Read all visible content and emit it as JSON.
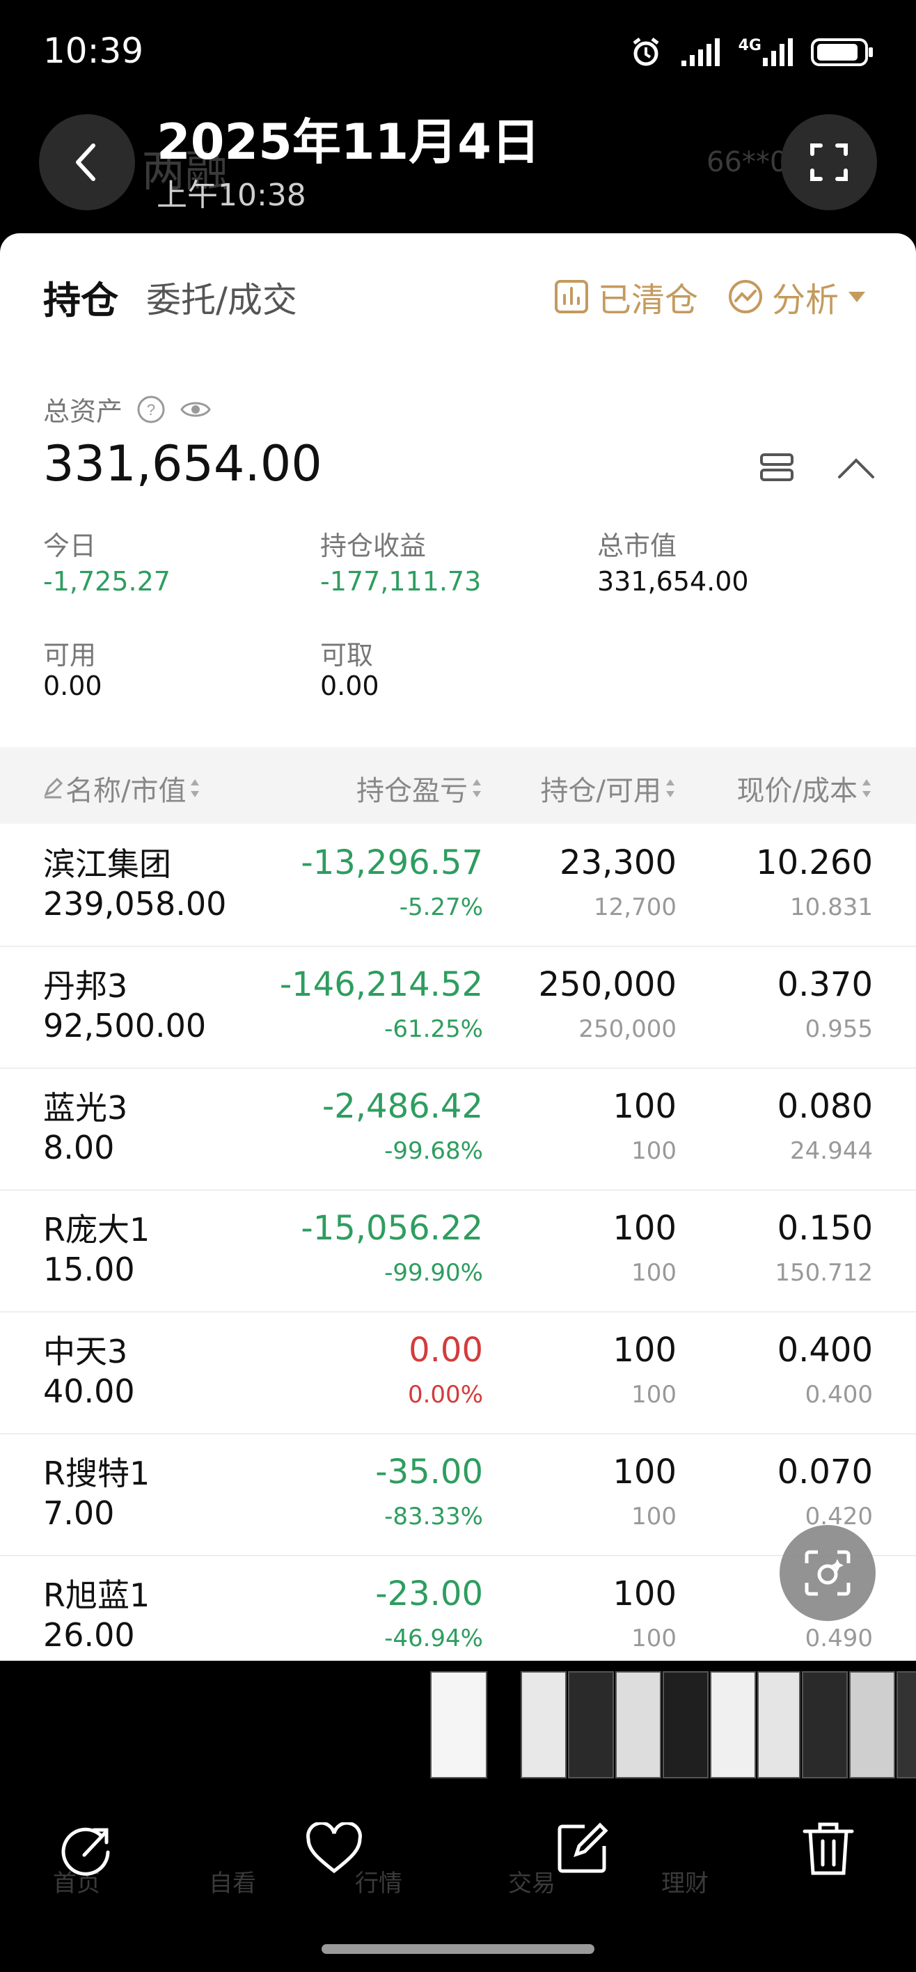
{
  "status_bar": {
    "time": "10:39",
    "network": "4G"
  },
  "header": {
    "title": "2025年11月4日",
    "subtitle": "上午10:38",
    "ghost_left": "普通  两融",
    "ghost_right": "66**0"
  },
  "tabs": {
    "active": "持仓",
    "other": "委托/成交"
  },
  "tools": {
    "cleared": "已清仓",
    "analysis": "分析"
  },
  "account": {
    "total_label": "总资产",
    "total_value": "331,654.00",
    "today_label": "今日",
    "today_value": "-1,725.27",
    "pl_label": "持仓收益",
    "pl_value": "-177,111.73",
    "mv_label": "总市值",
    "mv_value": "331,654.00",
    "avail_label": "可用",
    "avail_value": "0.00",
    "withdraw_label": "可取",
    "withdraw_value": "0.00"
  },
  "table": {
    "headers": [
      "名称/市值",
      "持仓盈亏",
      "持仓/可用",
      "现价/成本"
    ],
    "rows": [
      {
        "name": "滨江集团",
        "mv": "239,058.00",
        "pl": "-13,296.57",
        "pl_pct": "-5.27%",
        "qty": "23,300",
        "avail": "12,700",
        "price": "10.260",
        "cost": "10.831",
        "sign": "neg"
      },
      {
        "name": "丹邦3",
        "mv": "92,500.00",
        "pl": "-146,214.52",
        "pl_pct": "-61.25%",
        "qty": "250,000",
        "avail": "250,000",
        "price": "0.370",
        "cost": "0.955",
        "sign": "neg"
      },
      {
        "name": "蓝光3",
        "mv": "8.00",
        "pl": "-2,486.42",
        "pl_pct": "-99.68%",
        "qty": "100",
        "avail": "100",
        "price": "0.080",
        "cost": "24.944",
        "sign": "neg"
      },
      {
        "name": "R庞大1",
        "mv": "15.00",
        "pl": "-15,056.22",
        "pl_pct": "-99.90%",
        "qty": "100",
        "avail": "100",
        "price": "0.150",
        "cost": "150.712",
        "sign": "neg"
      },
      {
        "name": "中天3",
        "mv": "40.00",
        "pl": "0.00",
        "pl_pct": "0.00%",
        "qty": "100",
        "avail": "100",
        "price": "0.400",
        "cost": "0.400",
        "sign": "zero"
      },
      {
        "name": "R搜特1",
        "mv": "7.00",
        "pl": "-35.00",
        "pl_pct": "-83.33%",
        "qty": "100",
        "avail": "100",
        "price": "0.070",
        "cost": "0.420",
        "sign": "neg"
      },
      {
        "name": "R旭蓝1",
        "mv": "26.00",
        "pl": "-23.00",
        "pl_pct": "-46.94%",
        "qty": "100",
        "avail": "100",
        "price": "",
        "cost": "0.490",
        "sign": "neg"
      }
    ]
  },
  "ghost_nav": [
    "首页",
    "自看",
    "行情",
    "交易",
    "理财"
  ],
  "colors": {
    "accent": "#c49a5e",
    "down": "#2e9d5f",
    "up": "#d43b3b"
  },
  "icons": [
    "back-icon",
    "fullscreen-icon",
    "chart-icon",
    "analysis-icon",
    "help-icon",
    "eye-icon",
    "layout-icon",
    "collapse-icon",
    "lens-icon",
    "share-icon",
    "heart-icon",
    "edit-icon",
    "delete-icon"
  ]
}
